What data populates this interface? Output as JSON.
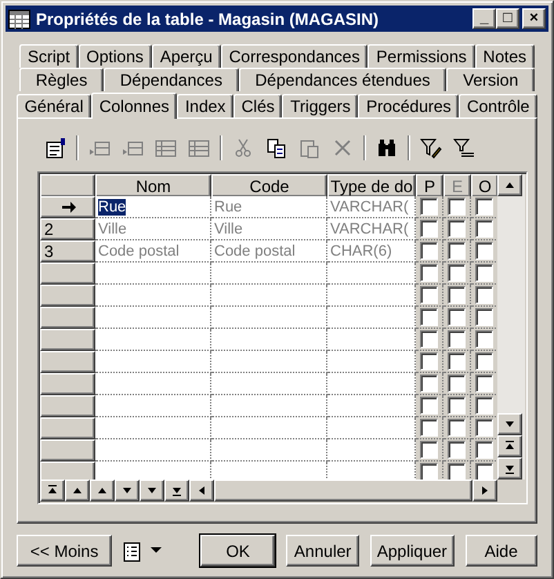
{
  "window": {
    "title": "Propriétés de la table - Magasin (MAGASIN)",
    "controls": [
      "_",
      "□",
      "×"
    ]
  },
  "tab_rows": [
    [
      {
        "label": "Script",
        "selected": false
      },
      {
        "label": "Options",
        "selected": false
      },
      {
        "label": "Aperçu",
        "selected": false
      },
      {
        "label": "Correspondances",
        "selected": false
      },
      {
        "label": "Permissions",
        "selected": false
      },
      {
        "label": "Notes",
        "selected": false
      }
    ],
    [
      {
        "label": "Règles",
        "selected": false
      },
      {
        "label": "Dépendances",
        "selected": false
      },
      {
        "label": "Dépendances étendues",
        "selected": false
      },
      {
        "label": "Version",
        "selected": false
      }
    ],
    [
      {
        "label": "Général",
        "selected": false
      },
      {
        "label": "Colonnes",
        "selected": true
      },
      {
        "label": "Index",
        "selected": false
      },
      {
        "label": "Clés",
        "selected": false
      },
      {
        "label": "Triggers",
        "selected": false
      },
      {
        "label": "Procédures",
        "selected": false
      },
      {
        "label": "Contrôle",
        "selected": false
      }
    ]
  ],
  "toolbar": [
    {
      "kind": "properties",
      "disabled": false
    },
    {
      "kind": "sep"
    },
    {
      "kind": "insert",
      "disabled": true
    },
    {
      "kind": "add",
      "disabled": true
    },
    {
      "kind": "add-rows",
      "disabled": true
    },
    {
      "kind": "remove-rows",
      "disabled": true
    },
    {
      "kind": "sep"
    },
    {
      "kind": "cut",
      "disabled": true
    },
    {
      "kind": "copy",
      "disabled": false
    },
    {
      "kind": "paste",
      "disabled": true
    },
    {
      "kind": "delete",
      "disabled": true
    },
    {
      "kind": "sep"
    },
    {
      "kind": "find",
      "disabled": false
    },
    {
      "kind": "sep"
    },
    {
      "kind": "filter-edit",
      "disabled": false
    },
    {
      "kind": "filter",
      "disabled": false
    }
  ],
  "grid": {
    "columns": [
      {
        "label": "Nom",
        "disabled": false
      },
      {
        "label": "Code",
        "disabled": false
      },
      {
        "label": "Type de do",
        "disabled": false
      },
      {
        "label": "P",
        "disabled": false
      },
      {
        "label": "E",
        "disabled": true
      },
      {
        "label": "O",
        "disabled": false
      }
    ],
    "rows": [
      {
        "current": true,
        "cells": [
          "Rue",
          "Rue",
          "VARCHAR("
        ],
        "selected": true,
        "checks": [
          false,
          false,
          false
        ]
      },
      {
        "current": false,
        "number": "2",
        "cells": [
          "Ville",
          "Ville",
          "VARCHAR("
        ],
        "selected": false,
        "checks": [
          false,
          false,
          false
        ]
      },
      {
        "current": false,
        "number": "3",
        "cells": [
          "Code postal",
          "Code postal",
          "CHAR(6)"
        ],
        "selected": false,
        "checks": [
          false,
          false,
          false
        ]
      },
      {
        "current": false,
        "checks": [
          false,
          false,
          false
        ]
      },
      {
        "current": false,
        "checks": [
          false,
          false,
          false
        ]
      },
      {
        "current": false,
        "checks": [
          false,
          false,
          false
        ]
      },
      {
        "current": false,
        "checks": [
          false,
          false,
          false
        ]
      },
      {
        "current": false,
        "checks": [
          false,
          false,
          false
        ]
      },
      {
        "current": false,
        "checks": [
          false,
          false,
          false
        ]
      },
      {
        "current": false,
        "checks": [
          false,
          false,
          false
        ]
      },
      {
        "current": false,
        "checks": [
          false,
          false,
          false
        ]
      },
      {
        "current": false,
        "checks": [
          false,
          false,
          false
        ]
      },
      {
        "current": false,
        "checks": [
          false,
          false,
          false
        ]
      }
    ]
  },
  "buttons": [
    {
      "label": "<< Moins",
      "default": false
    },
    {
      "label": "OK",
      "default": true
    },
    {
      "label": "Annuler",
      "default": false
    },
    {
      "label": "Appliquer",
      "default": false
    },
    {
      "label": "Aide",
      "default": false
    }
  ]
}
